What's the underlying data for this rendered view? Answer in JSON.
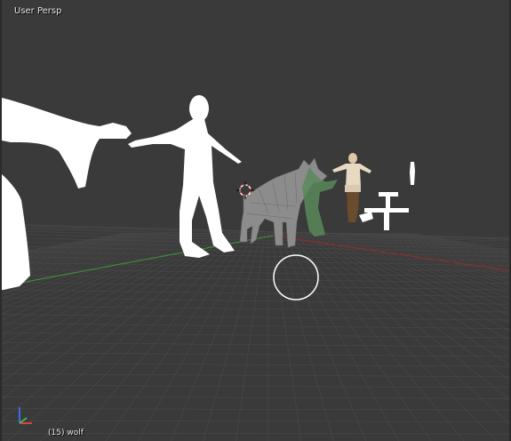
{
  "viewport": {
    "view_name": "User Persp",
    "frame_number": "(15)",
    "active_object": "wolf",
    "status_text": "(15) wolf"
  },
  "scene_objects": [
    {
      "name": "horse-silhouette",
      "color": "#ffffff"
    },
    {
      "name": "human-silhouette",
      "color": "#ffffff"
    },
    {
      "name": "wolf-mesh",
      "color": "#8c8c8c"
    },
    {
      "name": "green-figure",
      "color": "#5a8a5a"
    },
    {
      "name": "textured-human",
      "color": "#e8d9c2"
    },
    {
      "name": "small-white-figure",
      "color": "#ffffff"
    },
    {
      "name": "white-object",
      "color": "#ffffff"
    }
  ],
  "widgets": {
    "cursor_3d": "3d-cursor-icon",
    "navigation_circle": "view-circle-icon",
    "axis_gizmo": "axis-gizmo-icon"
  },
  "colors": {
    "background": "#3a3a3a",
    "grid": "#4a4a4a",
    "x_axis": "#8a2f2f",
    "y_axis": "#3c8a3c"
  }
}
